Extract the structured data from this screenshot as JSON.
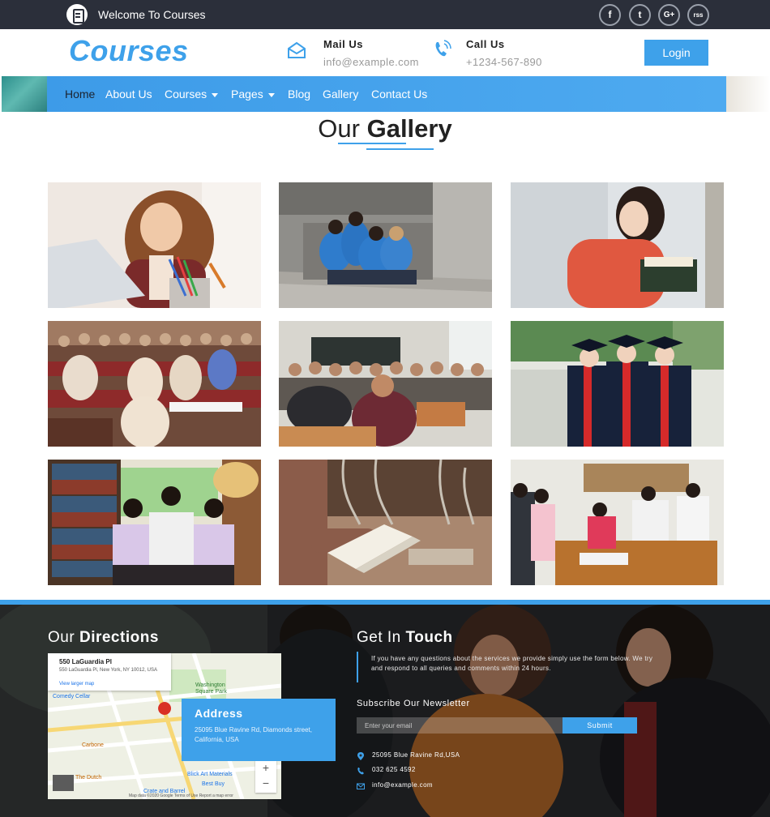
{
  "topbar": {
    "welcome": "Welcome To Courses",
    "social": [
      {
        "icon": "facebook-icon",
        "glyph": "f"
      },
      {
        "icon": "twitter-icon",
        "glyph": "t"
      },
      {
        "icon": "google-plus-icon",
        "glyph": "G+"
      },
      {
        "icon": "rss-icon",
        "glyph": "rss"
      }
    ]
  },
  "header": {
    "brand": "Courses",
    "mail_label": "Mail Us",
    "mail_value": "info@example.com",
    "call_label": "Call Us",
    "call_value": "+1234-567-890",
    "login": "Login"
  },
  "nav": {
    "items": [
      "Home",
      "About Us",
      "Courses",
      "Pages",
      "Blog",
      "Gallery",
      "Contact Us"
    ],
    "active": "Home"
  },
  "gallery": {
    "title_light": "Our",
    "title_bold": "Gallery",
    "images": [
      "student-studying-laptop",
      "students-sitting-on-steps",
      "girl-reading-book",
      "lecture-hall-students",
      "classroom-students",
      "graduates-in-gowns",
      "students-in-library",
      "hand-holding-book",
      "children-in-classroom"
    ]
  },
  "footer": {
    "directions_light": "Our",
    "directions_bold": "Directions",
    "map": {
      "place": "550 LaGuardia Pl",
      "place_address": "550 LaGuardia Pl, New York, NY 10012, USA",
      "larger_map": "View larger map",
      "labels": [
        "Comedy Cellar",
        "Washington Square Park",
        "Carbone",
        "The Dutch",
        "Blick Art Materials",
        "Best Buy",
        "Crate and Barrel"
      ],
      "footer_text": "Map data ©2020 Google   Terms of Use   Report a map error",
      "zoom_in": "+",
      "zoom_out": "−"
    },
    "address_title": "Address",
    "address_value": "25095 Blue Ravine Rd, Diamonds street, California, USA",
    "touch_light": "Get In",
    "touch_bold": "Touch",
    "touch_text": "If you have any questions about the services we provide simply use the form below. We try and respond to all queries and comments within 24 hours.",
    "newsletter_title": "Subscribe Our Newsletter",
    "email_placeholder": "Enter your email",
    "submit": "Submit",
    "contacts": [
      {
        "icon": "location-pin-icon",
        "text": "25095 Blue Ravine Rd,USA"
      },
      {
        "icon": "phone-icon",
        "text": "032 625 4592"
      },
      {
        "icon": "envelope-icon",
        "text": "info@example.com"
      }
    ]
  }
}
